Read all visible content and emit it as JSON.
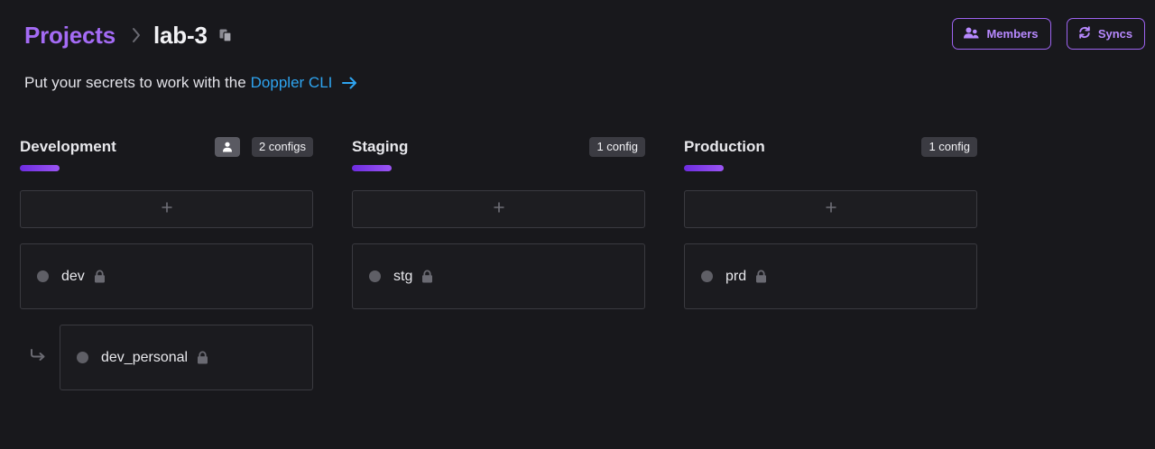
{
  "breadcrumb": {
    "projects_label": "Projects",
    "project_name": "lab-3"
  },
  "actions": {
    "members_label": "Members",
    "syncs_label": "Syncs"
  },
  "cli": {
    "prefix": "Put your secrets to work with the",
    "link_text": "Doppler CLI"
  },
  "environments": [
    {
      "name": "Development",
      "badge": "2 configs",
      "has_personal_badge": true,
      "configs": [
        {
          "name": "dev",
          "locked": true
        }
      ],
      "branch_configs": [
        {
          "name": "dev_personal",
          "locked": true
        }
      ]
    },
    {
      "name": "Staging",
      "badge": "1 config",
      "configs": [
        {
          "name": "stg",
          "locked": true
        }
      ]
    },
    {
      "name": "Production",
      "badge": "1 config",
      "configs": [
        {
          "name": "prd",
          "locked": true
        }
      ]
    }
  ],
  "colors": {
    "accent_purple": "#a46bf5",
    "link_blue": "#2ea4f0",
    "background": "#18181c"
  }
}
